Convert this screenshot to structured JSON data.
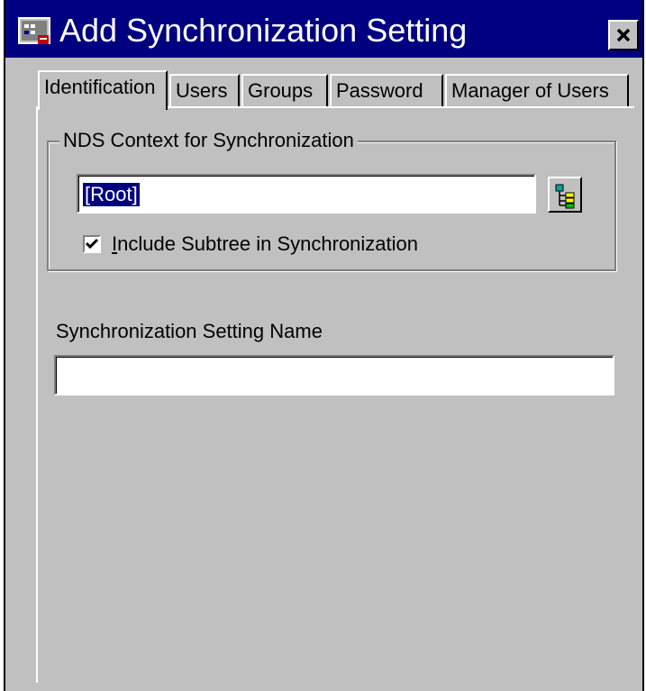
{
  "window": {
    "title": "Add Synchronization Setting"
  },
  "titlebar": {
    "icon": "app-icon",
    "close_icon": "close-icon"
  },
  "tabs": [
    {
      "label": "Identification",
      "active": true
    },
    {
      "label": "Users",
      "active": false
    },
    {
      "label": "Groups",
      "active": false
    },
    {
      "label": "Password",
      "active": false
    },
    {
      "label": "Manager of Users",
      "active": false
    }
  ],
  "nds_group": {
    "legend": "NDS Context for Synchronization",
    "context_value": "[Root]",
    "browse_icon": "tree-browse-icon",
    "include_subtree": {
      "checked": true,
      "label_mnemonic": "I",
      "label_rest": "nclude Subtree in Synchronization"
    }
  },
  "setting_name": {
    "label": "Synchronization Setting Name",
    "value": ""
  },
  "colors": {
    "titlebar": "#000080",
    "face": "#c0c0c0",
    "selection": "#000080"
  }
}
